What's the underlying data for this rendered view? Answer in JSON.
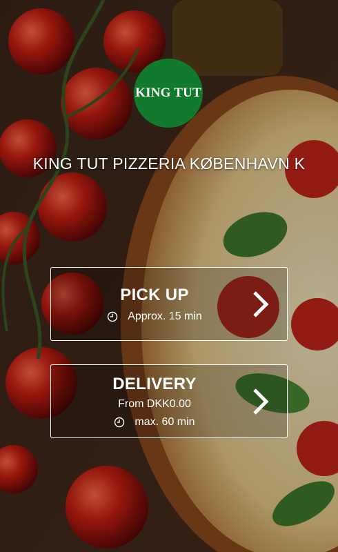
{
  "logo": {
    "text": "KING TUT"
  },
  "restaurant": {
    "name": "KING TUT PIZZERIA KØBENHAVN K"
  },
  "pickup": {
    "title": "PICK UP",
    "time": "Approx. 15 min"
  },
  "delivery": {
    "title": "DELIVERY",
    "min_order": "From DKK0.00",
    "time": "max. 60 min"
  },
  "colors": {
    "logo_bg": "#127a2c",
    "text": "#ffffff"
  },
  "icons": [
    "clock-icon",
    "chevron-right-icon"
  ]
}
